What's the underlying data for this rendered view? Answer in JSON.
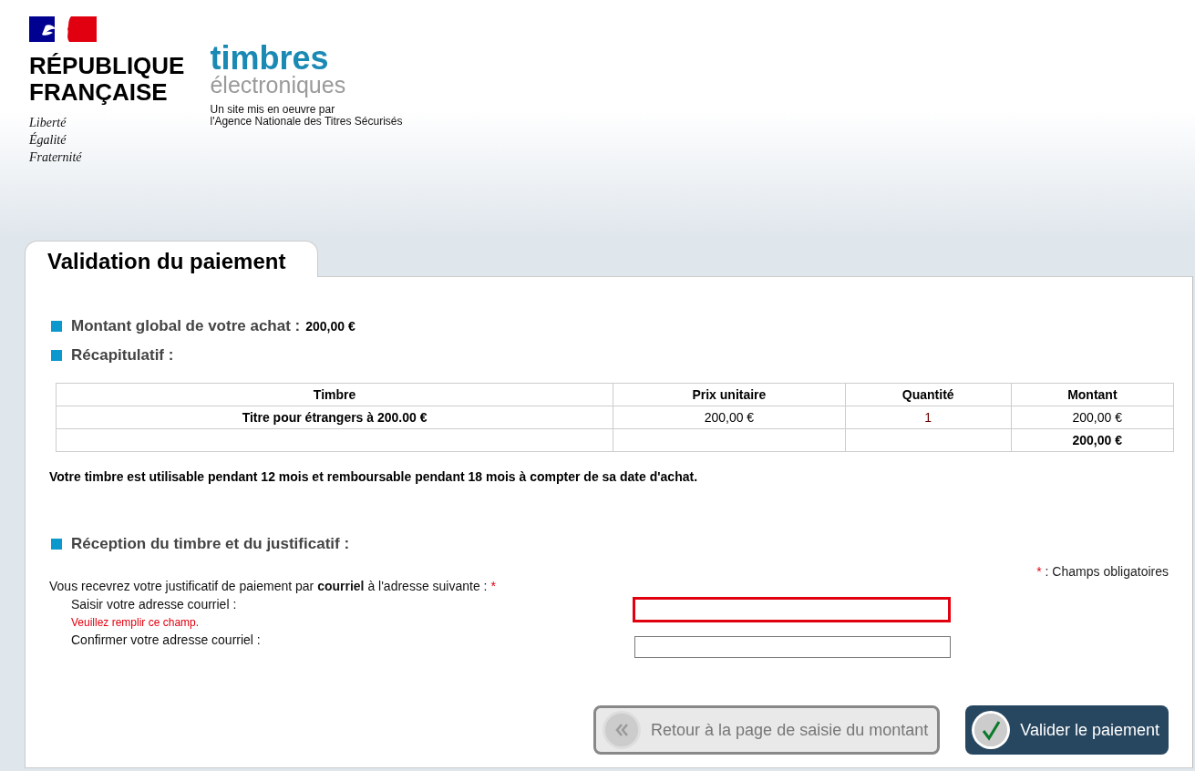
{
  "header": {
    "republic": [
      "RÉPUBLIQUE",
      "FRANÇAISE"
    ],
    "motto": [
      "Liberté",
      "Égalité",
      "Fraternité"
    ],
    "site_title": "timbres",
    "site_subtitle": "électroniques",
    "operator": [
      "Un site mis en oeuvre par",
      "l'Agence Nationale des Titres Sécurisés"
    ]
  },
  "tab": {
    "label": "Validation du paiement"
  },
  "summary": [
    {
      "label": "Montant global de votre achat :",
      "value": "200,00 €"
    },
    {
      "label": "Récapitulatif :"
    }
  ],
  "table": {
    "columns": [
      "Timbre",
      "Prix unitaire",
      "Quantité",
      "Montant"
    ],
    "rows": [
      [
        "Titre pour étrangers à 200.00 €",
        "200,00 €",
        "1",
        "200,00 €"
      ]
    ],
    "total": "200,00 €"
  },
  "note": "Votre timbre est utilisable pendant 12 mois et remboursable pendant 18 mois à compter de sa date d'achat.",
  "reception": {
    "heading": "Réception du timbre et du justificatif :",
    "required_mark": "*",
    "required_text": ": Champs obligatoires",
    "intro": "Vous recevrez votre justificatif de paiement par **courriel** à l'adresse suivante :",
    "intro_mark": "*",
    "fields": [
      {
        "label": "Saisir votre adresse courriel :",
        "error": "Veuillez remplir ce champ.",
        "invalid": true
      },
      {
        "label": "Confirmer votre adresse courriel :",
        "invalid": false
      }
    ]
  },
  "buttons": [
    {
      "kind": "back",
      "label": "Retour à la page de saisie du montant",
      "disabled": true
    },
    {
      "kind": "submit",
      "label": "Valider le paiement",
      "disabled": false
    }
  ]
}
